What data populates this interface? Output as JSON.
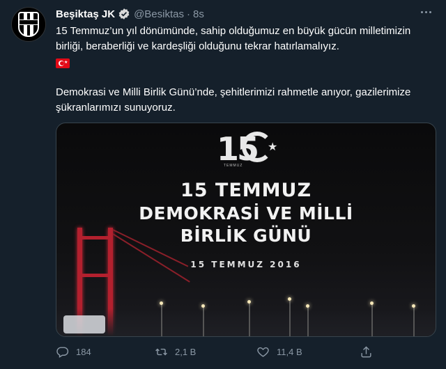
{
  "tweet": {
    "display_name": "Beşiktaş JK",
    "handle": "@Besiktas",
    "separator": "·",
    "time": "8s",
    "paragraph1": "15 Temmuz’un yıl dönümünde, sahip olduğumuz en büyük gücün milletimizin birliği, beraberliği ve kardeşliği olduğunu tekrar hatırlamalıyız.",
    "paragraph2": "Demokrasi ve Milli Birlik Günü’nde, şehitlerimizi rahmetle anıyor, gazilerimize şükranlarımızı sunuyoruz."
  },
  "media": {
    "logo_number": "15",
    "logo_sub": "TEMMUZ",
    "headline_line1": "15 TEMMUZ",
    "headline_line2": "DEMOKRASİ VE MİLLİ",
    "headline_line3": "BİRLİK GÜNÜ",
    "date": "15 TEMMUZ 2016"
  },
  "actions": {
    "reply_count": "184",
    "retweet_count": "2,1 B",
    "like_count": "11,4 B"
  },
  "icons": {
    "verified": "verified-badge-icon",
    "more": "more-options-icon",
    "reply": "reply-icon",
    "retweet": "retweet-icon",
    "like": "heart-icon",
    "share": "share-icon",
    "flag": "turkey-flag-icon"
  },
  "colors": {
    "background": "#15202b",
    "secondary_text": "#8b98a5",
    "verified_blue": "#1d9bf0",
    "bridge_red": "#b3202e"
  }
}
